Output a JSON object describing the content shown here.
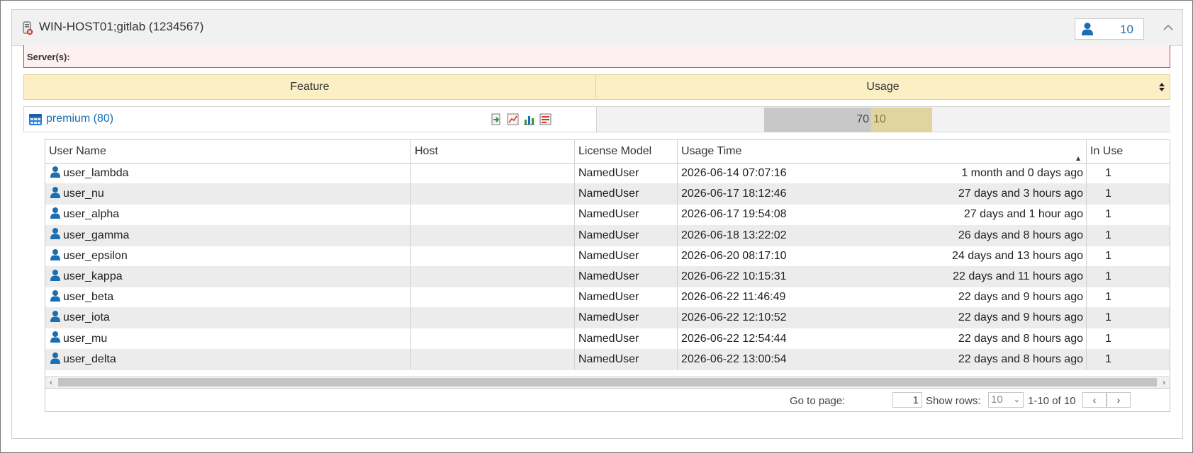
{
  "panel": {
    "title": "WIN-HOST01;gitlab (1234567)",
    "user_count": "10",
    "collapse_icon": "chevron-up-icon"
  },
  "server_bar": {
    "label": "Server(s):"
  },
  "feature_table": {
    "headers": {
      "feature": "Feature",
      "usage": "Usage"
    },
    "feature": {
      "name": "premium (80)",
      "used": "70",
      "available": "10",
      "used_fraction": 0.875,
      "actions": [
        "export-icon",
        "line-chart-icon",
        "bar-chart-icon",
        "report-icon"
      ]
    }
  },
  "grid": {
    "columns": {
      "user": "User Name",
      "host": "Host",
      "model": "License Model",
      "time": "Usage Time",
      "inuse": "In Use"
    },
    "rows": [
      {
        "user": "user_lambda",
        "host": "",
        "model": "NamedUser",
        "time": "2026-06-14 07:07:16",
        "ago": "1 month and 0 days ago",
        "inuse": "1"
      },
      {
        "user": "user_nu",
        "host": "",
        "model": "NamedUser",
        "time": "2026-06-17 18:12:46",
        "ago": "27 days and 3 hours ago",
        "inuse": "1"
      },
      {
        "user": "user_alpha",
        "host": "",
        "model": "NamedUser",
        "time": "2026-06-17 19:54:08",
        "ago": "27 days and 1 hour ago",
        "inuse": "1"
      },
      {
        "user": "user_gamma",
        "host": "",
        "model": "NamedUser",
        "time": "2026-06-18 13:22:02",
        "ago": "26 days and 8 hours ago",
        "inuse": "1"
      },
      {
        "user": "user_epsilon",
        "host": "",
        "model": "NamedUser",
        "time": "2026-06-20 08:17:10",
        "ago": "24 days and 13 hours ago",
        "inuse": "1"
      },
      {
        "user": "user_kappa",
        "host": "",
        "model": "NamedUser",
        "time": "2026-06-22 10:15:31",
        "ago": "22 days and 11 hours ago",
        "inuse": "1"
      },
      {
        "user": "user_beta",
        "host": "",
        "model": "NamedUser",
        "time": "2026-06-22 11:46:49",
        "ago": "22 days and 9 hours ago",
        "inuse": "1"
      },
      {
        "user": "user_iota",
        "host": "",
        "model": "NamedUser",
        "time": "2026-06-22 12:10:52",
        "ago": "22 days and 9 hours ago",
        "inuse": "1"
      },
      {
        "user": "user_mu",
        "host": "",
        "model": "NamedUser",
        "time": "2026-06-22 12:54:44",
        "ago": "22 days and 8 hours ago",
        "inuse": "1"
      },
      {
        "user": "user_delta",
        "host": "",
        "model": "NamedUser",
        "time": "2026-06-22 13:00:54",
        "ago": "22 days and 8 hours ago",
        "inuse": "1"
      }
    ]
  },
  "pager": {
    "goto_label": "Go to page:",
    "page": "1",
    "show_rows_label": "Show rows:",
    "rows_per_page": "10",
    "range": "1-10 of 10",
    "prev_icon": "chevron-left-icon",
    "next_icon": "chevron-right-icon"
  }
}
